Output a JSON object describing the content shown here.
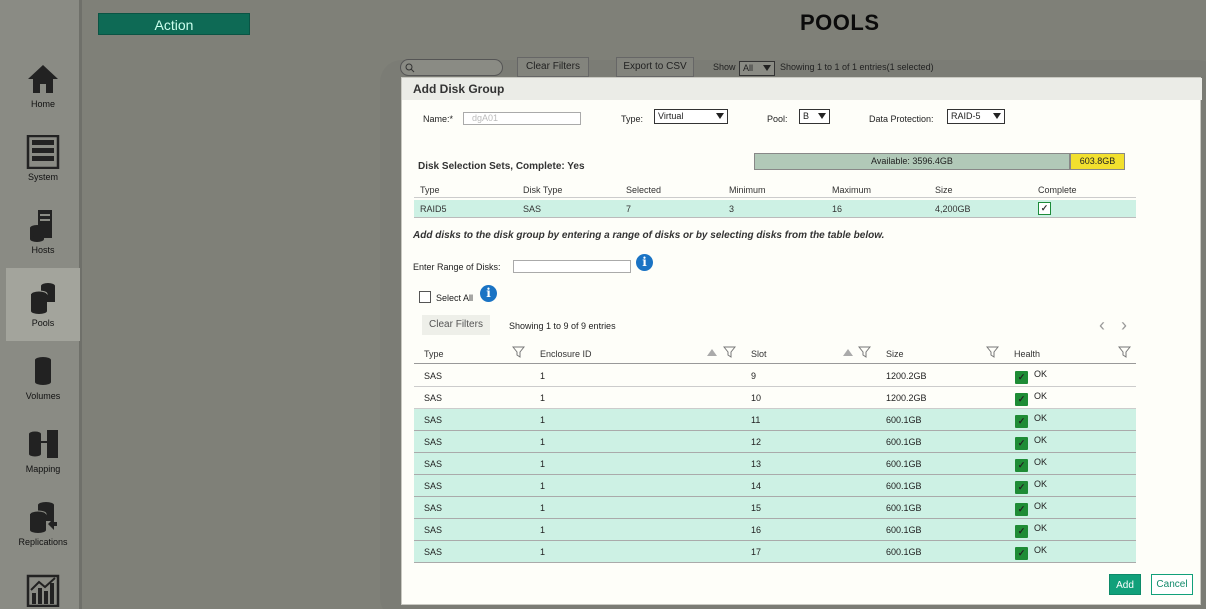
{
  "sidebar": {
    "items": [
      {
        "label": "Home",
        "icon": "home-icon"
      },
      {
        "label": "System",
        "icon": "system-icon"
      },
      {
        "label": "Hosts",
        "icon": "hosts-icon"
      },
      {
        "label": "Pools",
        "icon": "pools-icon",
        "active": true
      },
      {
        "label": "Volumes",
        "icon": "volumes-icon"
      },
      {
        "label": "Mapping",
        "icon": "mapping-icon"
      },
      {
        "label": "Replications",
        "icon": "replications-icon"
      },
      {
        "label": "",
        "icon": "performance-icon"
      }
    ]
  },
  "header": {
    "action_label": "Action",
    "page_title": "POOLS"
  },
  "background_toolbar": {
    "clear_filters": "Clear Filters",
    "export_csv": "Export to CSV",
    "show_label": "Show",
    "show_value": "All",
    "entries_text": "Showing 1 to 1 of 1 entries(1 selected)"
  },
  "dialog": {
    "title": "Add Disk Group",
    "name_label": "Name:*",
    "name_value": "dgA01",
    "type_label": "Type:",
    "type_value": "Virtual",
    "pool_label": "Pool:",
    "pool_value": "B",
    "protection_label": "Data Protection:",
    "protection_value": "RAID-5",
    "available_text": "Available: 3596.4GB",
    "used_text": "603.8GB",
    "sets_title": "Disk Selection Sets, Complete: Yes",
    "sets_headers": [
      "Type",
      "Disk Type",
      "Selected",
      "Minimum",
      "Maximum",
      "Size",
      "Complete"
    ],
    "sets_row": [
      "RAID5",
      "SAS",
      "7",
      "3",
      "16",
      "4,200GB"
    ],
    "instructions": "Add disks to the disk group by entering a range of disks or by selecting disks from the table below.",
    "range_label": "Enter Range of Disks:",
    "range_value": "",
    "select_all_label": "Select All",
    "clear_filters": "Clear Filters",
    "showing_text": "Showing 1 to 9 of 9 entries",
    "table_headers": [
      "Type",
      "Enclosure ID",
      "Slot",
      "Size",
      "Health"
    ],
    "rows": [
      {
        "type": "SAS",
        "enclosure": "1",
        "slot": "9",
        "size": "1200.2GB",
        "health": "OK",
        "selected": false
      },
      {
        "type": "SAS",
        "enclosure": "1",
        "slot": "10",
        "size": "1200.2GB",
        "health": "OK",
        "selected": false
      },
      {
        "type": "SAS",
        "enclosure": "1",
        "slot": "11",
        "size": "600.1GB",
        "health": "OK",
        "selected": true
      },
      {
        "type": "SAS",
        "enclosure": "1",
        "slot": "12",
        "size": "600.1GB",
        "health": "OK",
        "selected": true
      },
      {
        "type": "SAS",
        "enclosure": "1",
        "slot": "13",
        "size": "600.1GB",
        "health": "OK",
        "selected": true
      },
      {
        "type": "SAS",
        "enclosure": "1",
        "slot": "14",
        "size": "600.1GB",
        "health": "OK",
        "selected": true
      },
      {
        "type": "SAS",
        "enclosure": "1",
        "slot": "15",
        "size": "600.1GB",
        "health": "OK",
        "selected": true
      },
      {
        "type": "SAS",
        "enclosure": "1",
        "slot": "16",
        "size": "600.1GB",
        "health": "OK",
        "selected": true
      },
      {
        "type": "SAS",
        "enclosure": "1",
        "slot": "17",
        "size": "600.1GB",
        "health": "OK",
        "selected": true
      }
    ],
    "add_label": "Add",
    "cancel_label": "Cancel"
  },
  "colors": {
    "accent": "#11a07a",
    "selected_row": "#cdf1e4",
    "health_ok": "#1f8c36",
    "used_bar": "#f2e02e"
  }
}
